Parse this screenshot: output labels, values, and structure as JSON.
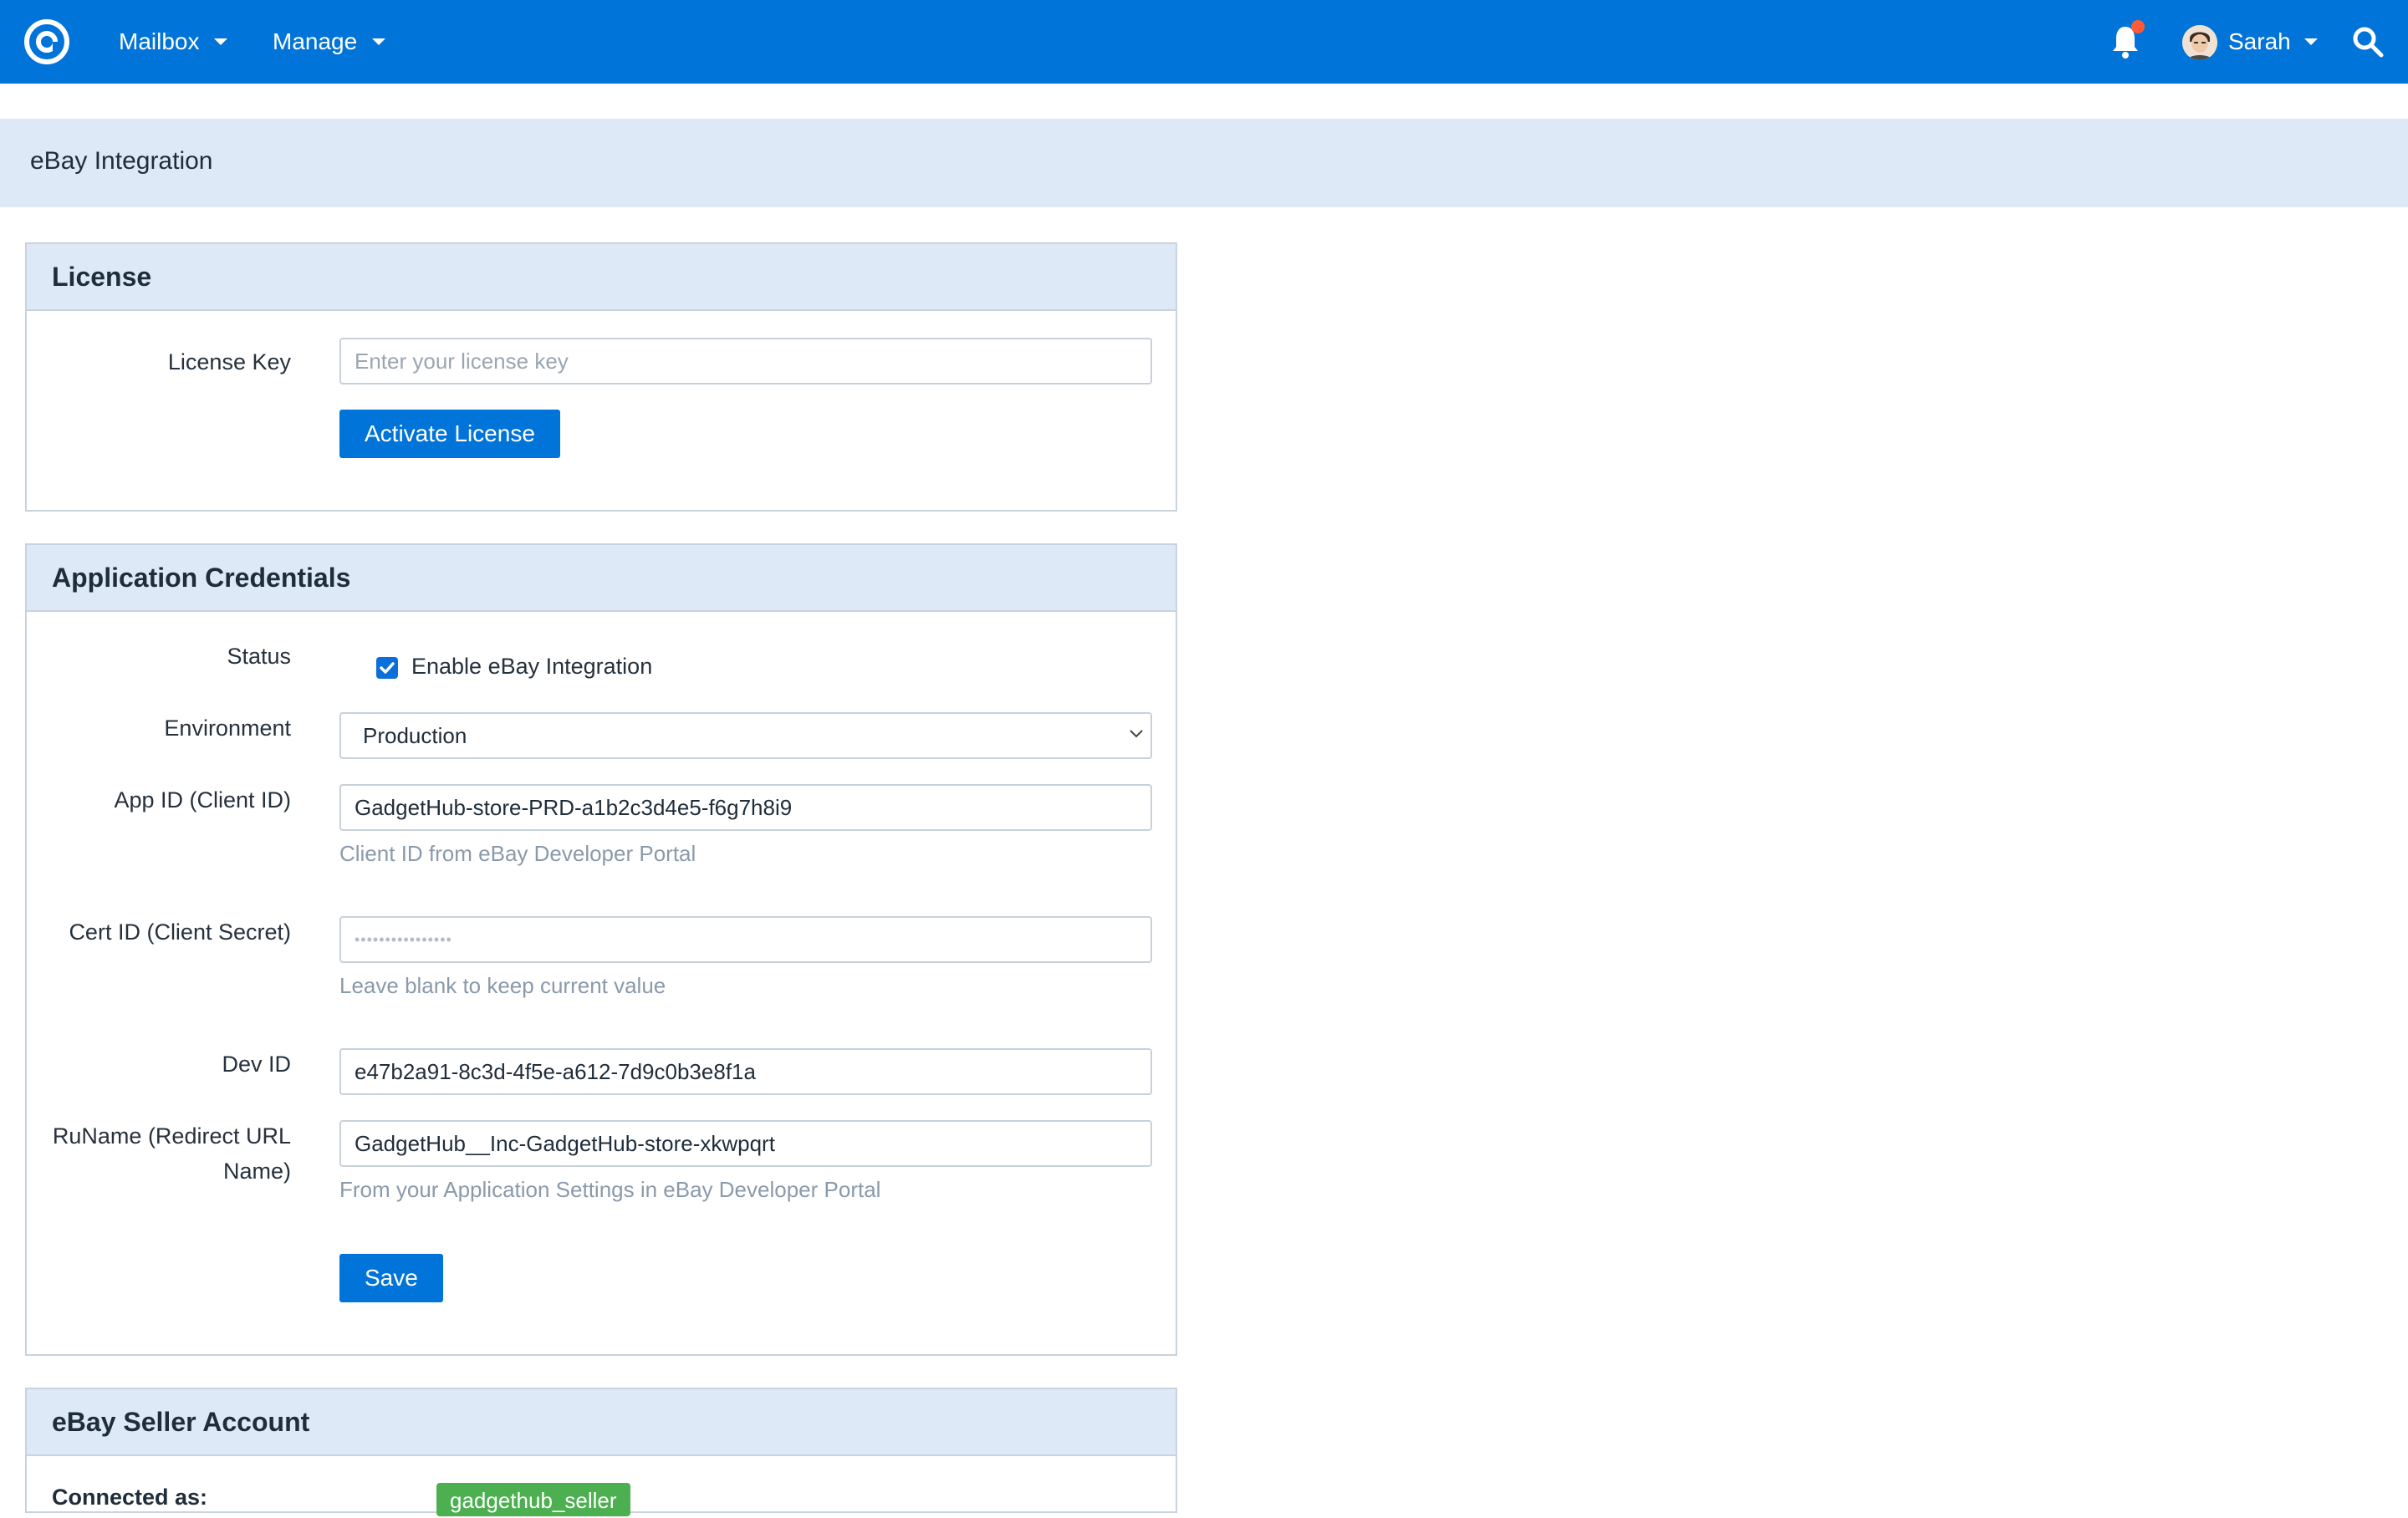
{
  "nav": {
    "mailbox": "Mailbox",
    "manage": "Manage",
    "user": "Sarah"
  },
  "page": {
    "title": "eBay Integration"
  },
  "license": {
    "heading": "License",
    "key_label": "License Key",
    "key_placeholder": "Enter your license key",
    "activate_button": "Activate License"
  },
  "credentials": {
    "heading": "Application Credentials",
    "status_label": "Status",
    "enable_label": "Enable eBay Integration",
    "enable_checked": true,
    "environment_label": "Environment",
    "environment_value": "Production",
    "app_id_label": "App ID (Client ID)",
    "app_id_value": "GadgetHub-store-PRD-a1b2c3d4e5-f6g7h8i9",
    "app_id_help": "Client ID from eBay Developer Portal",
    "cert_id_label": "Cert ID (Client Secret)",
    "cert_id_value": "••••••••••••••••",
    "cert_id_help": "Leave blank to keep current value",
    "dev_id_label": "Dev ID",
    "dev_id_value": "e47b2a91-8c3d-4f5e-a612-7d9c0b3e8f1a",
    "runame_label_line1": "RuName (Redirect URL",
    "runame_label_line2": "Name)",
    "runame_value": "GadgetHub__Inc-GadgetHub-store-xkwpqrt",
    "runame_help": "From your Application Settings in eBay Developer Portal",
    "save_button": "Save"
  },
  "seller": {
    "heading": "eBay Seller Account",
    "connected_label": "Connected as:",
    "connected_value": "gadgethub_seller"
  },
  "colors": {
    "brand": "#0074d8",
    "band": "#dde9f6",
    "badge": "#4caf50",
    "notification": "#ff5a36"
  },
  "icons": [
    "app-logo-icon",
    "bell-icon",
    "avatar",
    "search-icon",
    "chevron-down-icon",
    "checkbox-checked-icon"
  ]
}
